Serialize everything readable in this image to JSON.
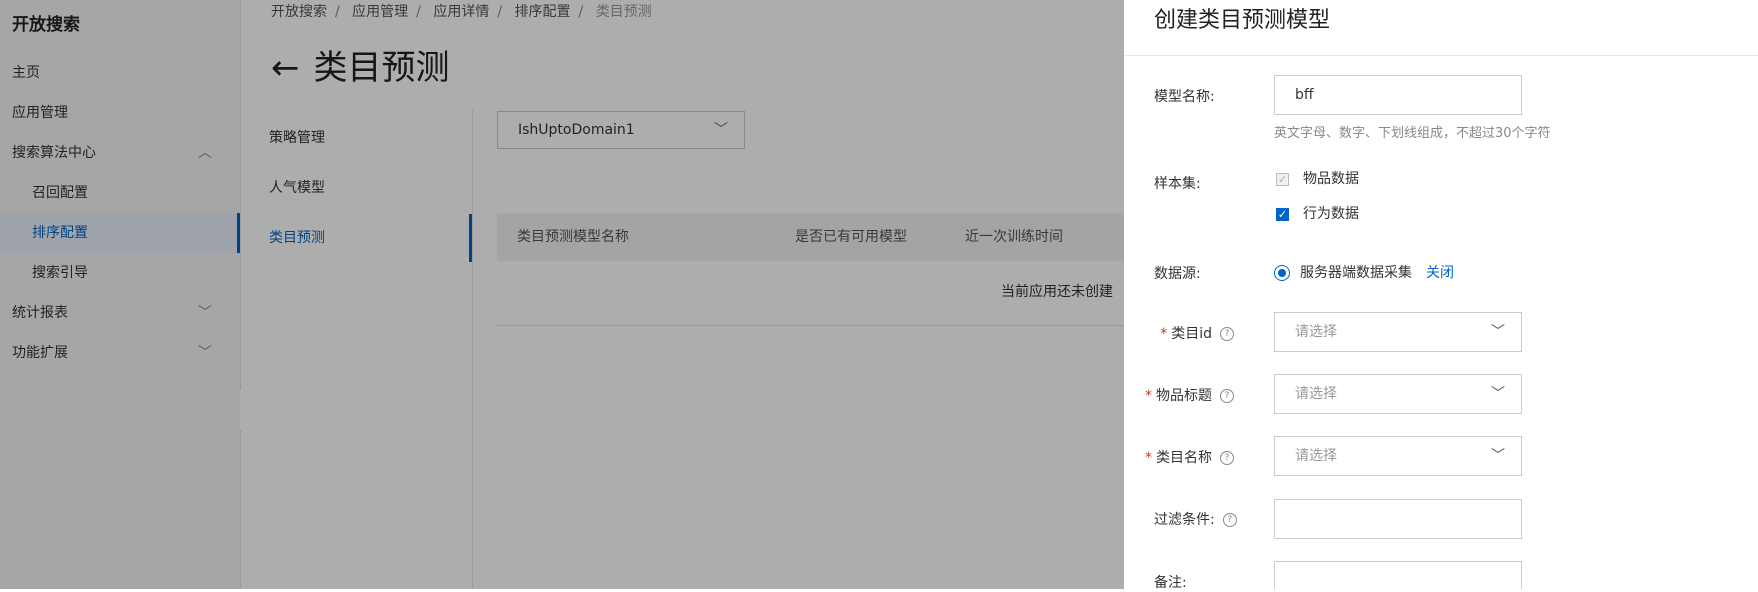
{
  "sidebar": {
    "brand": "开放搜索",
    "items": [
      {
        "label": "主页"
      },
      {
        "label": "应用管理"
      },
      {
        "label": "搜索算法中心",
        "caret": "^"
      },
      {
        "label": "召回配置"
      },
      {
        "label": "排序配置"
      },
      {
        "label": "搜索引导"
      },
      {
        "label": "统计报表",
        "caret": "v"
      },
      {
        "label": "功能扩展",
        "caret": "v"
      }
    ],
    "collapse_icon": "chevron-left-icon"
  },
  "breadcrumb": [
    "开放搜索",
    "应用管理",
    "应用详情",
    "排序配置",
    "类目预测"
  ],
  "page": {
    "back_icon": "←",
    "title": "类目预测"
  },
  "subnav": [
    {
      "label": "策略管理"
    },
    {
      "label": "人气模型"
    },
    {
      "label": "类目预测"
    }
  ],
  "domain_select": {
    "value": "IshUptoDomain1"
  },
  "table": {
    "columns": [
      "类目预测模型名称",
      "是否已有可用模型",
      "近一次训练时间"
    ],
    "empty_text": "当前应用还未创建"
  },
  "drawer": {
    "title": "创建类目预测模型",
    "model_name": {
      "label": "模型名称:",
      "value": "bff",
      "hint": "英文字母、数字、下划线组成，不超过30个字符"
    },
    "sample_set": {
      "label": "样本集:",
      "options": [
        {
          "label": "物品数据",
          "checked": true,
          "disabled": true
        },
        {
          "label": "行为数据",
          "checked": true,
          "disabled": false
        }
      ]
    },
    "data_source": {
      "label": "数据源:",
      "option": "服务器端数据采集",
      "action": "关闭"
    },
    "category_id": {
      "label": "类目id",
      "placeholder": "请选择"
    },
    "item_title": {
      "label": "物品标题",
      "placeholder": "请选择"
    },
    "category_name": {
      "label": "类目名称",
      "placeholder": "请选择"
    },
    "filter": {
      "label": "过滤条件:",
      "value": ""
    },
    "remark": {
      "label": "备注:",
      "value": ""
    }
  },
  "colors": {
    "accent": "#0064c8",
    "required": "#d93026"
  }
}
